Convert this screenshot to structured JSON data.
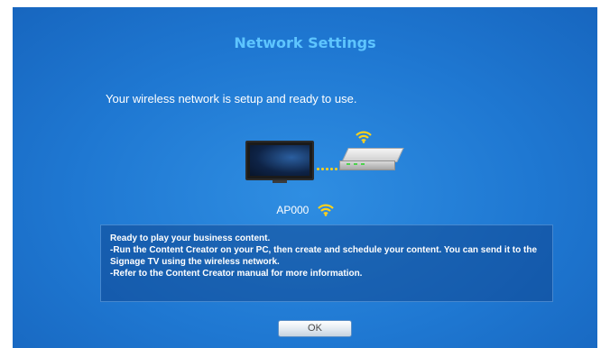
{
  "dialog": {
    "title": "Network Settings",
    "message": "Your wireless network is setup and ready to use."
  },
  "network": {
    "ssid": "AP000",
    "signal_icon": "wifi-icon",
    "signal_color": "#ffd21a"
  },
  "info": {
    "lines": [
      "Ready to play your business content.",
      "-Run the Content Creator on your PC, then create and schedule your content. You can send it to the Signage TV using the wireless network.",
      "-Refer to the Content Creator manual for more information."
    ]
  },
  "buttons": {
    "ok_label": "OK"
  },
  "colors": {
    "background": "#1f78d2",
    "title": "#5ec5ff",
    "accent": "#ffd21a"
  }
}
